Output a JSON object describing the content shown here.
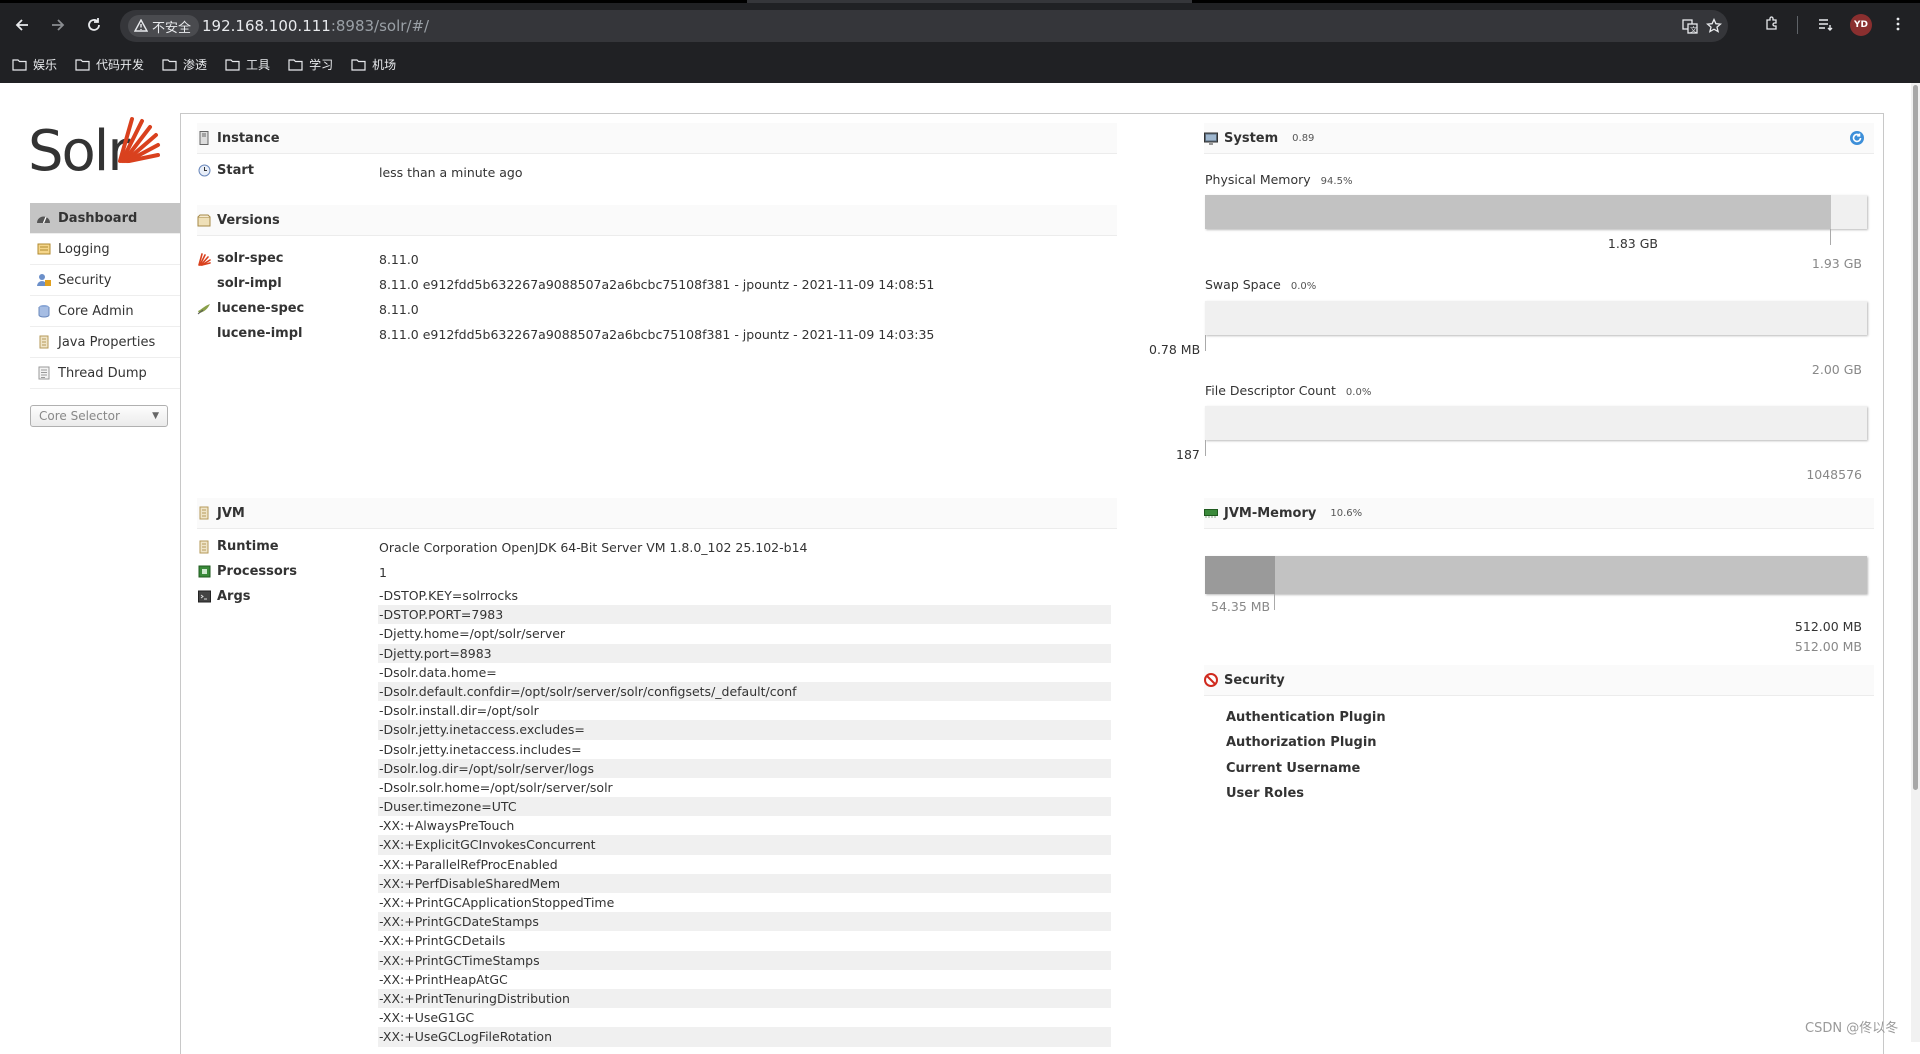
{
  "browser": {
    "security_label": "不安全",
    "url_host": "192.168.100.111",
    "url_rest": ":8983/solr/#/",
    "avatar_initials": "YD",
    "bookmarks": [
      "娱乐",
      "代码开发",
      "渗透",
      "工具",
      "学习",
      "机场"
    ]
  },
  "sidebar": {
    "logo_text": "Solr",
    "items": [
      {
        "label": "Dashboard",
        "icon": "dashboard-icon"
      },
      {
        "label": "Logging",
        "icon": "logging-icon"
      },
      {
        "label": "Security",
        "icon": "security-icon"
      },
      {
        "label": "Core Admin",
        "icon": "core-admin-icon"
      },
      {
        "label": "Java Properties",
        "icon": "java-properties-icon"
      },
      {
        "label": "Thread Dump",
        "icon": "thread-dump-icon"
      }
    ],
    "core_selector": "Core Selector"
  },
  "instance": {
    "title": "Instance",
    "start_label": "Start",
    "start_value": "less than a minute ago"
  },
  "versions": {
    "title": "Versions",
    "rows": [
      {
        "label": "solr-spec",
        "value": "8.11.0"
      },
      {
        "label": "solr-impl",
        "value": "8.11.0 e912fdd5b632267a9088507a2a6bcbc75108f381 - jpountz - 2021-11-09 14:08:51"
      },
      {
        "label": "lucene-spec",
        "value": "8.11.0"
      },
      {
        "label": "lucene-impl",
        "value": "8.11.0 e912fdd5b632267a9088507a2a6bcbc75108f381 - jpountz - 2021-11-09 14:03:35"
      }
    ]
  },
  "jvm": {
    "title": "JVM",
    "runtime_label": "Runtime",
    "runtime_value": "Oracle Corporation OpenJDK 64-Bit Server VM 1.8.0_102 25.102-b14",
    "processors_label": "Processors",
    "processors_value": "1",
    "args_label": "Args",
    "args": [
      "-DSTOP.KEY=solrrocks",
      "-DSTOP.PORT=7983",
      "-Djetty.home=/opt/solr/server",
      "-Djetty.port=8983",
      "-Dsolr.data.home=",
      "-Dsolr.default.confdir=/opt/solr/server/solr/configsets/_default/conf",
      "-Dsolr.install.dir=/opt/solr",
      "-Dsolr.jetty.inetaccess.excludes=",
      "-Dsolr.jetty.inetaccess.includes=",
      "-Dsolr.log.dir=/opt/solr/server/logs",
      "-Dsolr.solr.home=/opt/solr/server/solr",
      "-Duser.timezone=UTC",
      "-XX:+AlwaysPreTouch",
      "-XX:+ExplicitGCInvokesConcurrent",
      "-XX:+ParallelRefProcEnabled",
      "-XX:+PerfDisableSharedMem",
      "-XX:+PrintGCApplicationStoppedTime",
      "-XX:+PrintGCDateStamps",
      "-XX:+PrintGCDetails",
      "-XX:+PrintGCTimeStamps",
      "-XX:+PrintHeapAtGC",
      "-XX:+PrintTenuringDistribution",
      "-XX:+UseG1GC",
      "-XX:+UseGCLogFileRotation"
    ]
  },
  "system": {
    "title": "System",
    "load": "0.89",
    "physical_memory": {
      "label": "Physical Memory",
      "pct_text": "94.5%",
      "fraction": 0.945,
      "used": "1.83 GB",
      "total": "1.93 GB"
    },
    "swap_space": {
      "label": "Swap Space",
      "pct_text": "0.0%",
      "fraction": 0.0,
      "used": "0.78 MB",
      "total": "2.00 GB"
    },
    "file_descriptors": {
      "label": "File Descriptor Count",
      "pct_text": "0.0%",
      "fraction": 0.0,
      "used": "187",
      "total": "1048576"
    }
  },
  "jvm_memory": {
    "title": "JVM-Memory",
    "pct_text": "10.6%",
    "used_fraction": 0.106,
    "committed_fraction": 1.0,
    "used": "54.35 MB",
    "committed": "512.00 MB",
    "max": "512.00 MB"
  },
  "security": {
    "title": "Security",
    "items": [
      "Authentication Plugin",
      "Authorization Plugin",
      "Current Username",
      "User Roles"
    ]
  },
  "watermark": "CSDN @佟以冬",
  "colors": {
    "solr_red": "#d9411e",
    "chrome_bg": "#202124",
    "bar_fill": "#c2c2c2"
  }
}
